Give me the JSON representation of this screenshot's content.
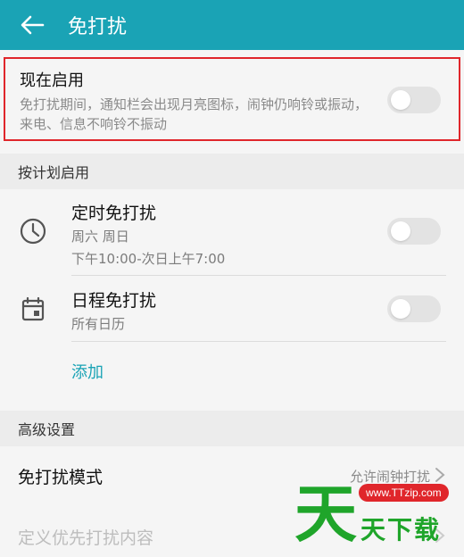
{
  "appbar": {
    "title": "免打扰"
  },
  "now": {
    "title": "现在启用",
    "description": "免打扰期间，通知栏会出现月亮图标，闹钟仍响铃或振动，来电、信息不响铃不振动",
    "enabled": false
  },
  "schedule": {
    "header": "按计划启用",
    "timed": {
      "label": "定时免打扰",
      "days": "周六 周日",
      "range": "下午10:00-次日上午7:00",
      "enabled": false
    },
    "calendar": {
      "label": "日程免打扰",
      "sub": "所有日历",
      "enabled": false
    },
    "add_label": "添加"
  },
  "advanced": {
    "header": "高级设置",
    "mode": {
      "label": "免打扰模式",
      "value": "允许闹钟打扰"
    },
    "priority": {
      "label": "定义优先打扰内容"
    }
  },
  "watermark": {
    "big": "天",
    "url": "www.TTzip.com",
    "text": "天下载"
  },
  "icons": {
    "back": "arrow-left-icon",
    "clock": "clock-icon",
    "calendar": "calendar-icon",
    "chevron": "chevron-right-icon"
  },
  "colors": {
    "accent": "#1aa3b5",
    "highlight": "#e0262b",
    "watermark": "#1fa52a"
  }
}
